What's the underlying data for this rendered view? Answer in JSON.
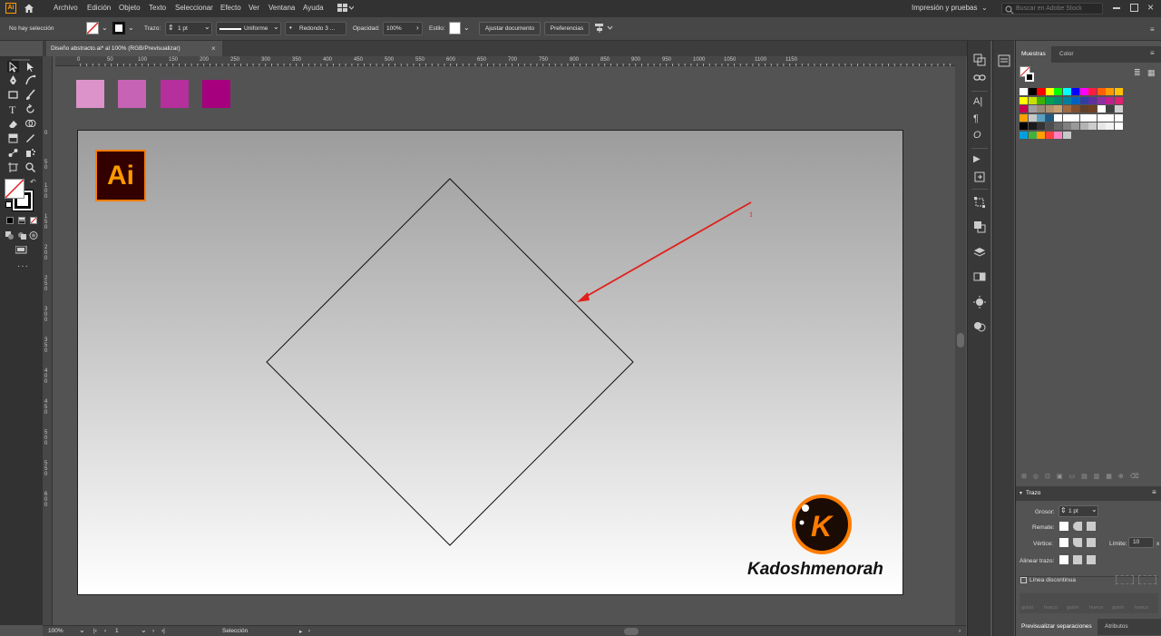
{
  "menubar": {
    "app_logo": "Ai",
    "items": [
      "Archivo",
      "Edición",
      "Objeto",
      "Texto",
      "Seleccionar",
      "Efecto",
      "Ver",
      "Ventana",
      "Ayuda"
    ],
    "workspace": "Impresión y pruebas",
    "search_placeholder": "Buscar en Adobe Stock"
  },
  "controlbar": {
    "selection_status": "No hay selección",
    "stroke_label": "Trazo:",
    "stroke_weight": "1 pt",
    "stroke_profile": "Uniforme",
    "brush": "Redondo 3 ...",
    "opacity_label": "Opacidad:",
    "opacity_value": "100%",
    "style_label": "Estilo:",
    "fit_document_button": "Ajustar documento",
    "preferences_button": "Preferencias"
  },
  "document": {
    "tab_title": "Diseño abstracto.ai* al 100% (RGB/Previsualizar)"
  },
  "ruler": {
    "h_labels": [
      "0",
      "50",
      "100",
      "150",
      "200",
      "250",
      "300",
      "350",
      "400",
      "450",
      "500",
      "550",
      "600",
      "650",
      "700",
      "750",
      "800",
      "850",
      "900",
      "950",
      "1000",
      "1050",
      "1100",
      "1150"
    ],
    "v_labels": [
      "0",
      "5\n0",
      "1\n0\n0",
      "1\n5\n0",
      "2\n0\n0",
      "2\n5\n0",
      "3\n0\n0",
      "3\n5\n0",
      "4\n0\n0",
      "4\n5\n0",
      "5\n0\n0",
      "5\n5\n0",
      "6\n0\n0"
    ]
  },
  "canvas": {
    "swatches": [
      "#dc93c9",
      "#c763b4",
      "#b5309c",
      "#a7007f"
    ],
    "ai_badge_text": "Ai",
    "annotation_number": "1",
    "watermark_letter": "K",
    "watermark_text": "Kadoshmenorah",
    "colors": {
      "arrow": "#e0201b",
      "badge_orange": "#ff7c00",
      "badge_dark": "#330000"
    }
  },
  "statusbar": {
    "zoom": "100%",
    "artboard_number": "1",
    "tool_name": "Selección"
  },
  "panels": {
    "swatches_tabs": [
      "Muestras",
      "Color"
    ],
    "swatch_colors": [
      [
        "#ffffff",
        "#000000",
        "#ff0000",
        "#ffff00",
        "#00ff00",
        "#00ffff",
        "#0000ff",
        "#ff00ff",
        "#ff1a40",
        "#ff6000",
        "#ff9a00",
        "#ffc000"
      ],
      [
        "#ffff00",
        "#c8e000",
        "#40b000",
        "#00a050",
        "#008a70",
        "#0080a0",
        "#0060c0",
        "#3040a0",
        "#6030a0",
        "#9030a0",
        "#c02090",
        "#e02070"
      ],
      [
        "#c80050",
        "#a0a0a0",
        "#9a8a78",
        "#b09070",
        "#c8a070",
        "#a06a40",
        "#805030",
        "#60402a",
        "#704020",
        "#ffffff",
        "#404040",
        "#d0d0d0"
      ],
      [
        "#ffa000",
        "#c8c8c8",
        "#5aa0c0",
        "#205a80",
        "#ffffff",
        "#ffffff",
        "#ffffff",
        "#ffffff",
        "#ffffff",
        "#ffffff",
        "#ffffff",
        "#ffffff"
      ],
      [
        "#000000",
        "#1a1a1a",
        "#333333",
        "#4d4d4d",
        "#666666",
        "#808080",
        "#999999",
        "#b3b3b3",
        "#cccccc",
        "#e6e6e6",
        "#f2f2f2",
        "#ffffff"
      ],
      [
        "#00a0e0",
        "#40b040",
        "#ffa000",
        "#ff4040",
        "#ff80c0",
        "#c8c8c8"
      ]
    ],
    "stroke_panel": {
      "title": "Trazo",
      "weight_label": "Grosor:",
      "weight_value": "1 pt",
      "cap_label": "Remate:",
      "corner_label": "Vértice:",
      "limit_label": "Límite:",
      "limit_value": "10",
      "limit_unit": "x",
      "align_label": "Alinear trazo:",
      "dashed_label": "Línea discontinua",
      "dash_labels": [
        "guión",
        "hueco",
        "guión",
        "hueco",
        "guión",
        "hueco"
      ]
    },
    "bottom_tabs": [
      "Previsualizar separaciones",
      "Atributos"
    ]
  }
}
